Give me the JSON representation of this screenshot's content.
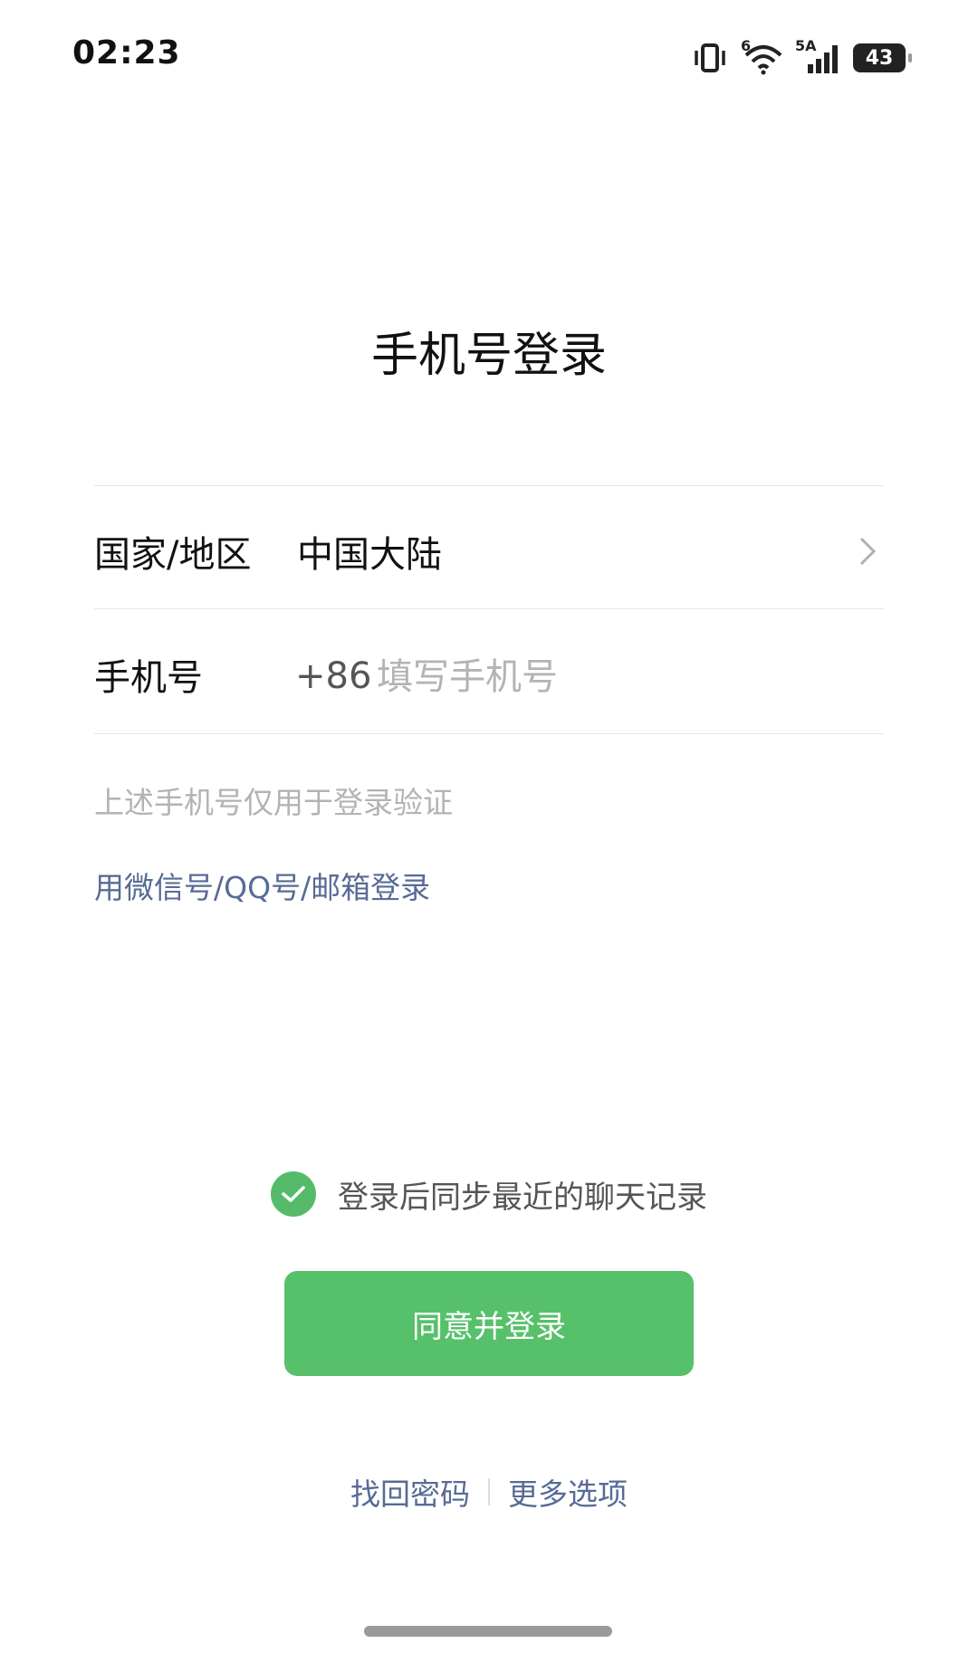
{
  "status_bar": {
    "time": "02:23",
    "network_label": "5A",
    "wifi_label": "6",
    "battery": "43",
    "icons": [
      "vibrate-icon",
      "wifi-icon",
      "signal-icon",
      "battery-icon"
    ]
  },
  "page": {
    "title": "手机号登录"
  },
  "form": {
    "region_label": "国家/地区",
    "region_value": "中国大陆",
    "phone_label": "手机号",
    "country_code": "+86",
    "phone_placeholder": "填写手机号",
    "phone_value": ""
  },
  "hint": "上述手机号仅用于登录验证",
  "alt_login": "用微信号/QQ号/邮箱登录",
  "sync": {
    "checked": true,
    "label": "登录后同步最近的聊天记录"
  },
  "login_button": "同意并登录",
  "footer": {
    "recover_password": "找回密码",
    "more_options": "更多选项"
  },
  "colors": {
    "accent_green": "#57c06b",
    "link_blue": "#576b95",
    "placeholder_gray": "#b3b3b3"
  }
}
